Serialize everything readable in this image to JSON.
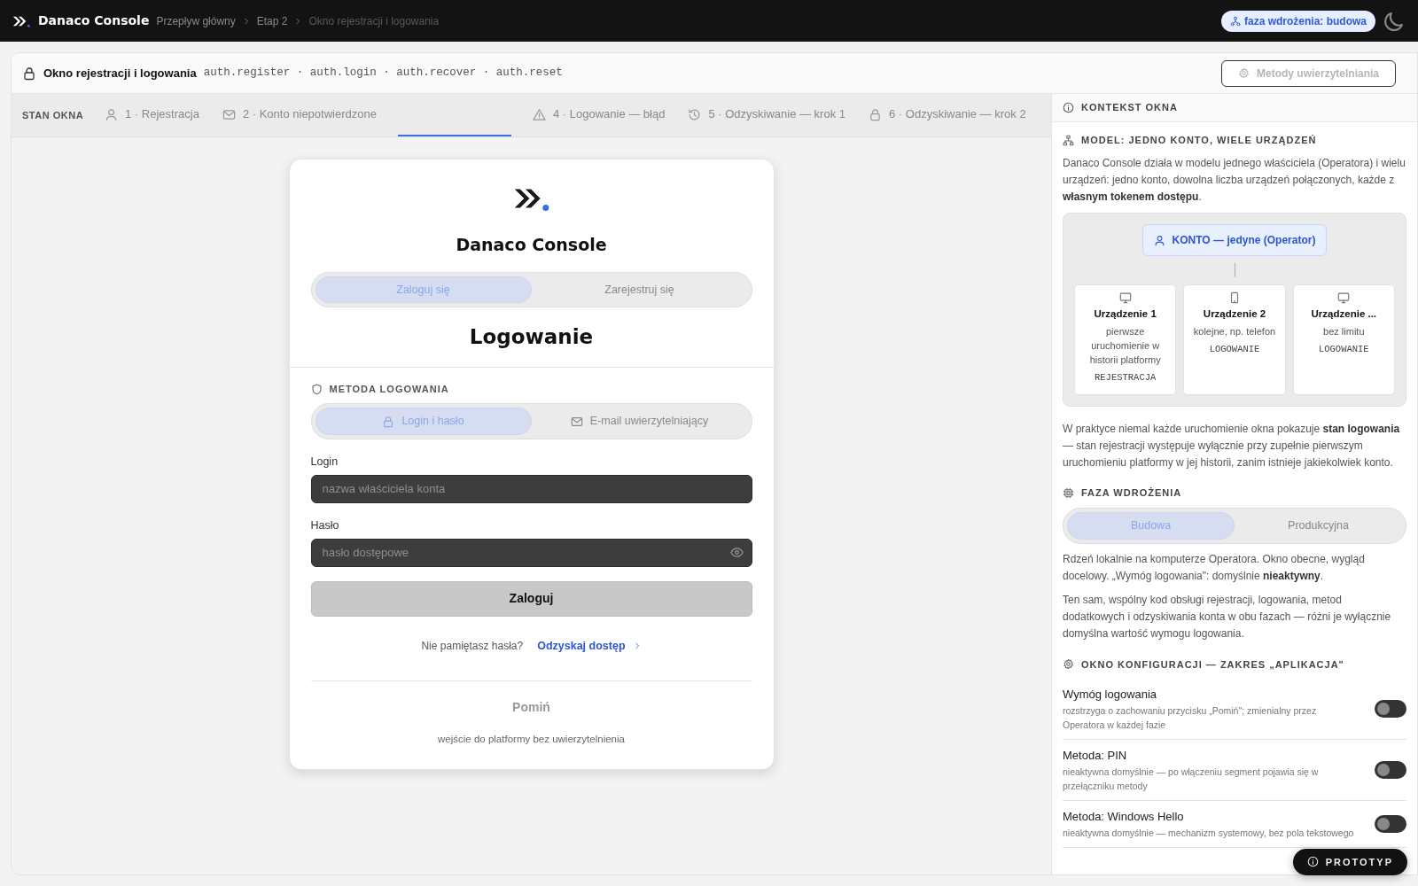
{
  "topbar": {
    "brand": "Danaco Console",
    "breadcrumbs": [
      "Przepływ główny",
      "Etap 2",
      "Okno rejestracji i logowania"
    ],
    "phase_badge": "faza wdrożenia: budowa"
  },
  "window_header": {
    "title": "Okno rejestracji i logowania",
    "codes": "auth.register · auth.login · auth.recover · auth.reset",
    "methods_button": {
      "label": "Metody uwierzytelniania",
      "disabled": true
    }
  },
  "state_bar": {
    "label": "STAN OKNA",
    "tabs": [
      {
        "label": "1 · Rejestracja",
        "selected": false
      },
      {
        "label": "2 · Konto niepotwierdzone",
        "selected": false
      },
      {
        "selected": true
      },
      {
        "label": "4 · Logowanie — błąd",
        "selected": false
      },
      {
        "label": "5 · Odzyskiwanie — krok 1",
        "selected": false
      },
      {
        "label": "6 · Odzyskiwanie — krok 2",
        "selected": false
      }
    ]
  },
  "login_card": {
    "brand": "Danaco Console",
    "mode_switch": [
      {
        "label": "Zaloguj się",
        "selected": true
      },
      {
        "label": "Zarejestruj się",
        "selected": false
      }
    ],
    "heading": "Logowanie",
    "method_title": "METODA LOGOWANIA",
    "methods": [
      {
        "label": "Login i hasło",
        "selected": true
      },
      {
        "label": "E-mail uwierzytelniający",
        "selected": false
      }
    ],
    "fields": [
      {
        "kind": "text",
        "label": "Login",
        "placeholder": "nazwa właściciela konta"
      },
      {
        "kind": "password",
        "label": "Hasło",
        "placeholder": "hasło dostępowe"
      }
    ],
    "submit": "Zaloguj",
    "recover_question": "Nie pamiętasz hasła?",
    "recover_link": "Odzyskaj dostęp",
    "skip": "Pomiń",
    "skip_note": "wejście do platformy bez uwierzytelnienia"
  },
  "context_panel": {
    "title": "KONTEKST OKNA",
    "model_title": "MODEL: JEDNO KONTO, WIELE URZĄDZEŃ",
    "model_text": "Danaco Console działa w modelu jednego właściciela (Operatora) i wielu urządzeń: jedno konto, dowolna liczba urządzeń połączonych, każde z **własnym tokenem dostępu**.",
    "account": "KONTO — jedyne (Operator)",
    "devices": [
      {
        "kind": "desktop",
        "name": "Urządzenie 1",
        "desc": "pierwsze uruchomienie w historii platformy",
        "tag": "REJESTRACJA"
      },
      {
        "kind": "phone",
        "name": "Urządzenie 2",
        "desc": "kolejne, np. telefon",
        "tag": "LOGOWANIE"
      },
      {
        "kind": "desktop",
        "name": "Urządzenie ...",
        "desc": "bez limitu",
        "tag": "LOGOWANIE"
      }
    ],
    "model_note": "W praktyce niemal każde uruchomienie okna pokazuje **stan logowania** — stan rejestracji występuje wyłącznie przy zupełnie pierwszym uruchomieniu platformy w jej historii, zanim istnieje jakiekolwiek konto.",
    "phase_title": "FAZA WDROŻENIA",
    "phases": [
      {
        "label": "Budowa",
        "selected": true
      },
      {
        "label": "Produkcyjna",
        "selected": false
      }
    ],
    "phase_texts": [
      "Rdzeń lokalnie na komputerze Operatora. Okno obecne, wygląd docelowy. „Wymóg logowania\": domyślnie **nieaktywny**.",
      "Ten sam, wspólny kod obsługi rejestracji, logowania, metod dodatkowych i odzyskiwania konta w obu fazach — różni je wyłącznie domyślna wartość wymogu logowania."
    ],
    "config_title": "OKNO KONFIGURACJI — ZAKRES „APLIKACJA\"",
    "settings": [
      {
        "title": "Wymóg logowania",
        "desc": "rozstrzyga o zachowaniu przycisku „Pomiń\"; zmienialny przez Operatora w każdej fazie",
        "on": false
      },
      {
        "title": "Metoda: PIN",
        "desc": "nieaktywna domyślnie — po włączeniu segment pojawia się w przełączniku metody",
        "on": false
      },
      {
        "title": "Metoda: Windows Hello",
        "desc": "nieaktywna domyślnie — mechanizm systemowy, bez pola tekstowego",
        "on": false
      }
    ]
  },
  "prototype_pill": "PROTOTYP"
}
